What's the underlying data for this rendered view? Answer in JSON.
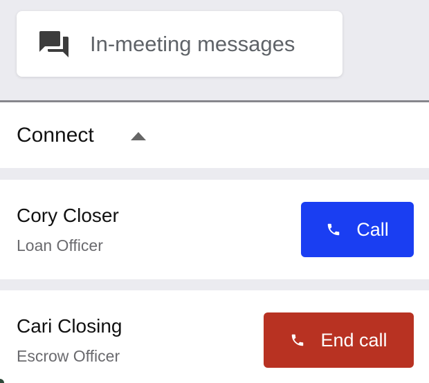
{
  "messages_button": {
    "label": "In-meeting messages",
    "icon": "chat-bubbles-icon"
  },
  "connect": {
    "title": "Connect",
    "toggle_icon": "caret-up-icon"
  },
  "contacts": [
    {
      "name": "Cory Closer",
      "role": "Loan Officer",
      "action_label": "Call",
      "action_icon": "phone-icon",
      "action_color": "#1a3ef2"
    },
    {
      "name": "Cari Closing",
      "role": "Escrow Officer",
      "action_label": "End call",
      "action_icon": "phone-icon",
      "action_color": "#b83222"
    }
  ],
  "colors": {
    "background": "#ebebf0",
    "card": "#ffffff",
    "call_blue": "#1a3ef2",
    "end_call_red": "#b83222",
    "label_gray": "#5f6368"
  }
}
